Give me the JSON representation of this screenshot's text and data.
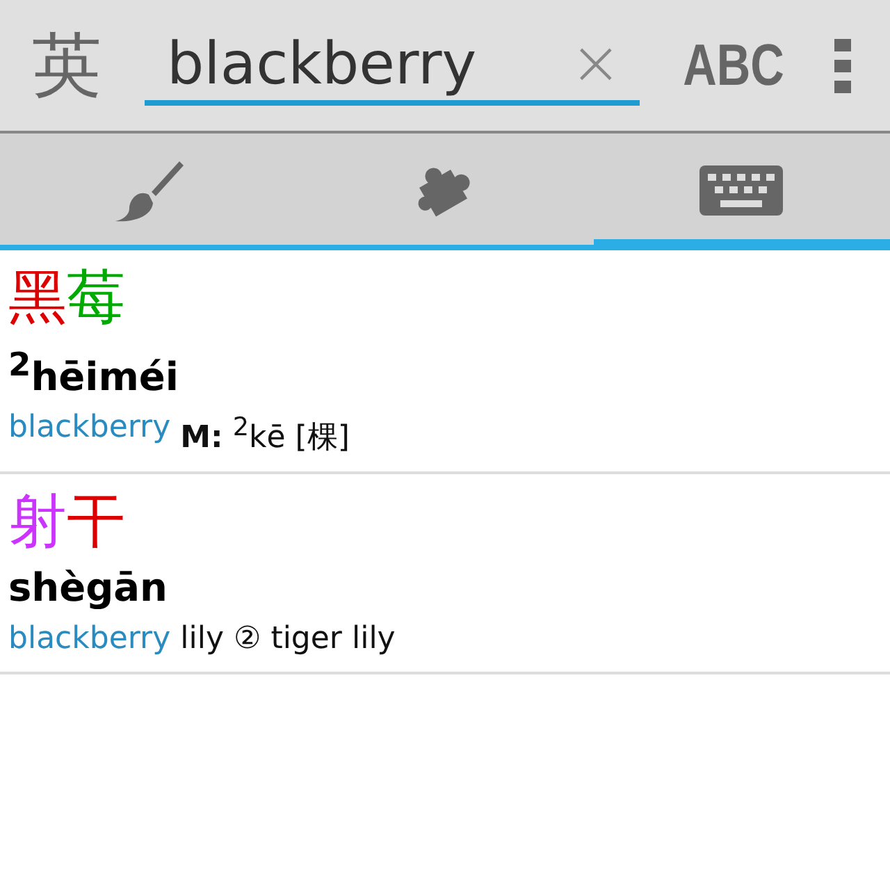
{
  "toolbar": {
    "language_button": "英",
    "search": {
      "value": "blackberry"
    },
    "clear_button": "×",
    "input_mode_button": "ABC"
  },
  "tabs": [
    {
      "kind": "brush",
      "selected": false
    },
    {
      "kind": "puzzle",
      "selected": false
    },
    {
      "kind": "keyboard",
      "selected": true
    }
  ],
  "entries": [
    {
      "characters": [
        {
          "text": "黑",
          "color": "#dd0000"
        },
        {
          "text": "莓",
          "color": "#00aa00"
        }
      ],
      "pinyin": "$^{2}$hēiméi",
      "match": "blackberry",
      "definition": "**M:** $^{2}$kē [棵]"
    },
    {
      "characters": [
        {
          "text": "射",
          "color": "#cc33ff"
        },
        {
          "text": "干",
          "color": "#dd0000"
        }
      ],
      "pinyin": "shègān",
      "match": "blackberry",
      "definition": "lily ② tiger lily"
    }
  ]
}
